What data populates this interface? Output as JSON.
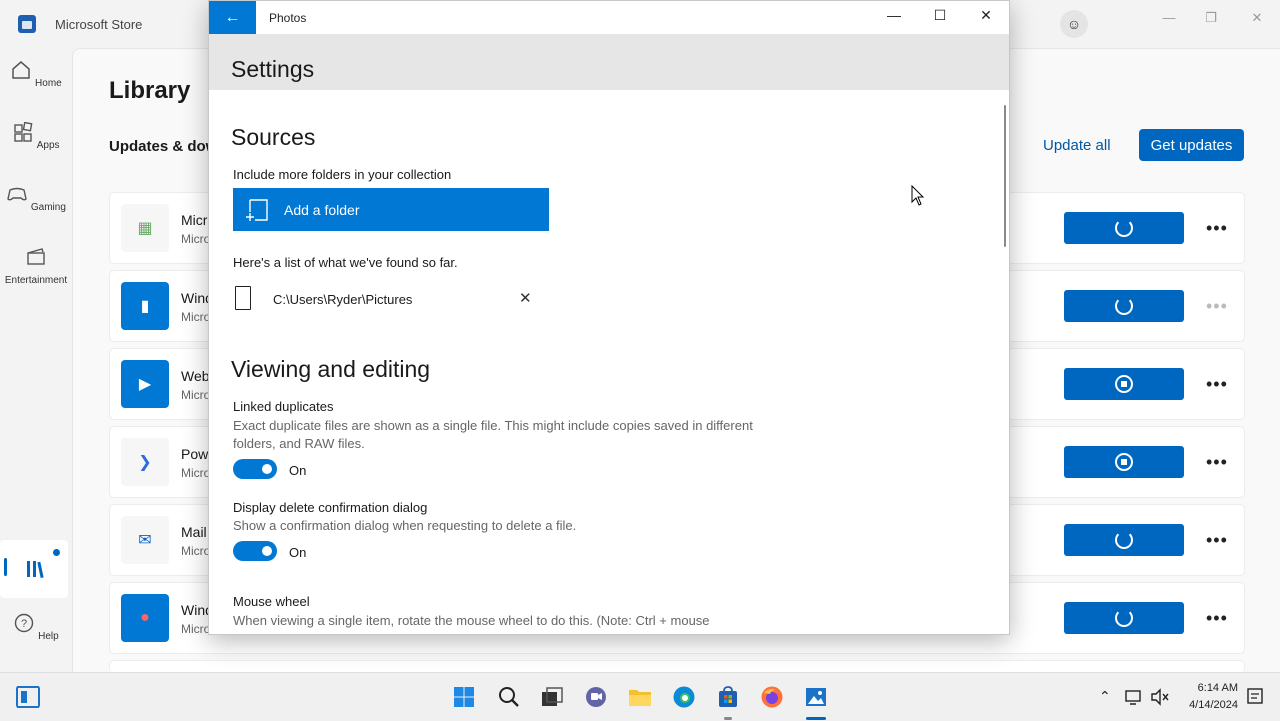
{
  "store": {
    "title": "Microsoft Store",
    "nav": [
      {
        "label": "Home",
        "icon": "home-icon"
      },
      {
        "label": "Apps",
        "icon": "apps-icon"
      },
      {
        "label": "Gaming",
        "icon": "gaming-icon"
      },
      {
        "label": "Entertainment",
        "icon": "entertainment-icon"
      },
      {
        "label": "Help",
        "icon": "help-icon"
      }
    ],
    "heading": "Library",
    "subheading": "Updates & dow",
    "update_all": "Update all",
    "get_updates": "Get updates",
    "apps": [
      {
        "name": "Micr",
        "publisher": "Micro",
        "icon_color": "#ffffff",
        "state": "spinner"
      },
      {
        "name": "Wind",
        "publisher": "Micro",
        "icon_color": "#0078d4",
        "state": "spinner"
      },
      {
        "name": "Web",
        "publisher": "Micro",
        "icon_color": "#0078d4",
        "state": "stop"
      },
      {
        "name": "Pow",
        "publisher": "Micro",
        "icon_color": "#ffffff",
        "state": "stop"
      },
      {
        "name": "Mail",
        "publisher": "Micro",
        "icon_color": "#ffffff",
        "state": "spinner"
      },
      {
        "name": "Wind",
        "publisher": "Micro",
        "icon_color": "#0078d4",
        "state": "spinner"
      }
    ]
  },
  "photos": {
    "window_title": "Photos",
    "header": "Settings",
    "sources": {
      "heading": "Sources",
      "include_label": "Include more folders in your collection",
      "add_folder": "Add a folder",
      "found_label": "Here's a list of what we've found so far.",
      "folder_path": "C:\\Users\\Ryder\\Pictures"
    },
    "viewing": {
      "heading": "Viewing and editing",
      "linked_title": "Linked duplicates",
      "linked_desc": "Exact duplicate files are shown as a single file. This might include copies saved in different folders, and RAW files.",
      "linked_state": "On",
      "delete_title": "Display delete confirmation dialog",
      "delete_desc": "Show a confirmation dialog when requesting to delete a file.",
      "delete_state": "On",
      "wheel_title": "Mouse wheel",
      "wheel_desc": "When viewing a single item, rotate the mouse wheel to do this. (Note: Ctrl + mouse"
    }
  },
  "taskbar": {
    "time": "6:14 AM",
    "date": "4/14/2024"
  },
  "colors": {
    "accent": "#0078d4",
    "store_accent": "#0067c0"
  }
}
